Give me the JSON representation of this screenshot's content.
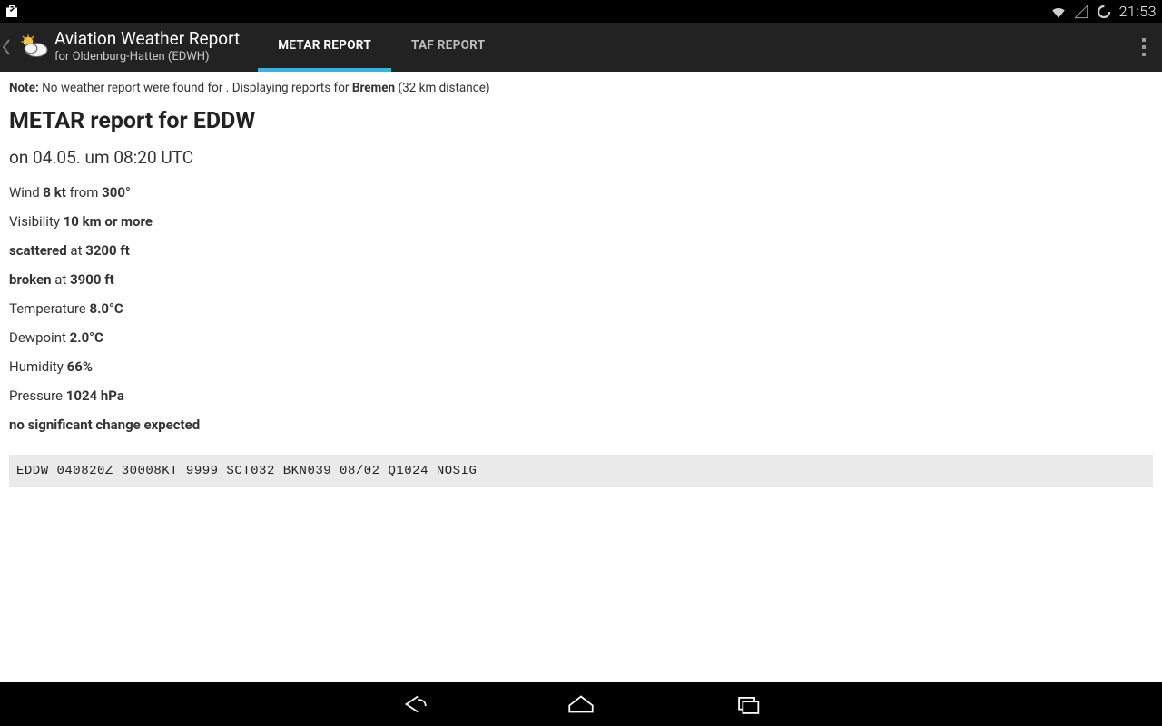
{
  "statusbar": {
    "time": "21:53"
  },
  "actionbar": {
    "title": "Aviation Weather Report",
    "subtitle": "for Oldenburg-Hatten (EDWH)",
    "tabs": {
      "metar": "METAR REPORT",
      "taf": "TAF REPORT"
    }
  },
  "note": {
    "label": "Note:",
    "pre": " No weather report were found for . Displaying reports for ",
    "station": "Bremen",
    "post": " (32 km distance)"
  },
  "report": {
    "heading": "METAR report for EDDW",
    "time": "on 04.05. um 08:20 UTC",
    "wind_label": "Wind ",
    "wind_speed": "8 kt",
    "wind_from": " from ",
    "wind_dir": "300°",
    "vis_label": "Visibility ",
    "vis_value": "10 km or more",
    "cloud1_type": "scattered",
    "cloud_at": " at ",
    "cloud1_alt": "3200 ft",
    "cloud2_type": "broken",
    "cloud2_alt": "3900 ft",
    "temp_label": "Temperature ",
    "temp_value": "8.0°C",
    "dew_label": "Dewpoint ",
    "dew_value": "2.0°C",
    "hum_label": "Humidity ",
    "hum_value": "66%",
    "press_label": "Pressure ",
    "press_value": "1024 hPa",
    "trend": "no significant change expected",
    "raw": "EDDW 040820Z 30008KT 9999 SCT032 BKN039 08/02 Q1024 NOSIG"
  }
}
